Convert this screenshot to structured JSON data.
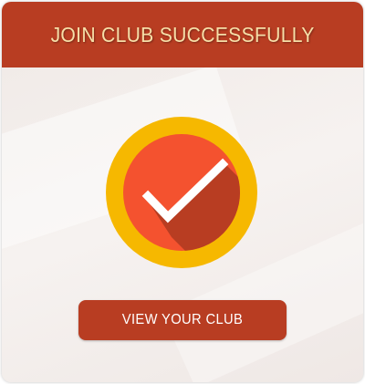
{
  "dialog": {
    "title": "JOIN CLUB SUCCESSFULLY",
    "button_label": "VIEW YOUR CLUB",
    "icon": "checkmark-badge-icon"
  },
  "colors": {
    "header": "#b83d22",
    "title_text": "#f6dfa8",
    "badge_ring": "#f6b800",
    "badge_fill": "#f4522f",
    "badge_shadow": "#b83d22",
    "check": "#ffffff",
    "button": "#b83d22"
  }
}
